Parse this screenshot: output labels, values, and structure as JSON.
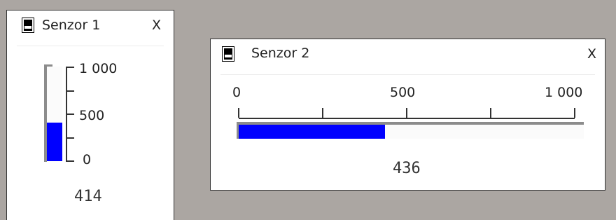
{
  "colors": {
    "desktop_bg": "#aba6a2",
    "fill": "#0000ff",
    "track": "#808080"
  },
  "icons": {
    "window_icon": "meter-icon",
    "close": "close-x"
  },
  "sensor1": {
    "title": "Senzor 1",
    "close_label": "X",
    "gauge": {
      "orientation": "vertical",
      "min": 0,
      "max": 1000,
      "value": 414,
      "ticks": [
        0,
        250,
        500,
        750,
        1000
      ],
      "labels": [
        "1 000",
        "500",
        "0"
      ]
    },
    "value_text": "414"
  },
  "sensor2": {
    "title": "Senzor 2",
    "close_label": "X",
    "gauge": {
      "orientation": "horizontal",
      "min": 0,
      "max": 1000,
      "value": 436,
      "ticks": [
        0,
        250,
        500,
        750,
        1000
      ],
      "labels": [
        "0",
        "500",
        "1 000"
      ]
    },
    "value_text": "436"
  }
}
